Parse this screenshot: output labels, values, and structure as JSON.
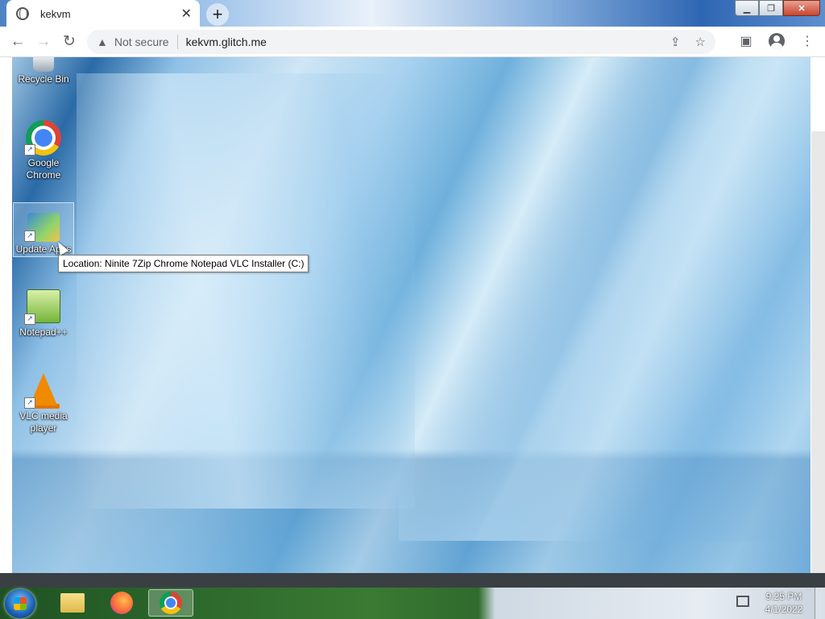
{
  "browser": {
    "tab": {
      "title": "kekvm"
    },
    "omnibox": {
      "security_label": "Not secure",
      "url": "kekvm.glitch.me"
    }
  },
  "remote_desktop": {
    "icons": [
      {
        "label": "Recycle Bin"
      },
      {
        "label": "Google Chrome"
      },
      {
        "label": "Update Apps"
      },
      {
        "label": "Notepad++"
      },
      {
        "label": "VLC media player"
      }
    ],
    "tooltip": "Location: Ninite 7Zip Chrome Notepad VLC Installer (C:)",
    "taskbar": {
      "clock_time": "9:25 PM",
      "clock_date": "4/1/2022"
    }
  }
}
